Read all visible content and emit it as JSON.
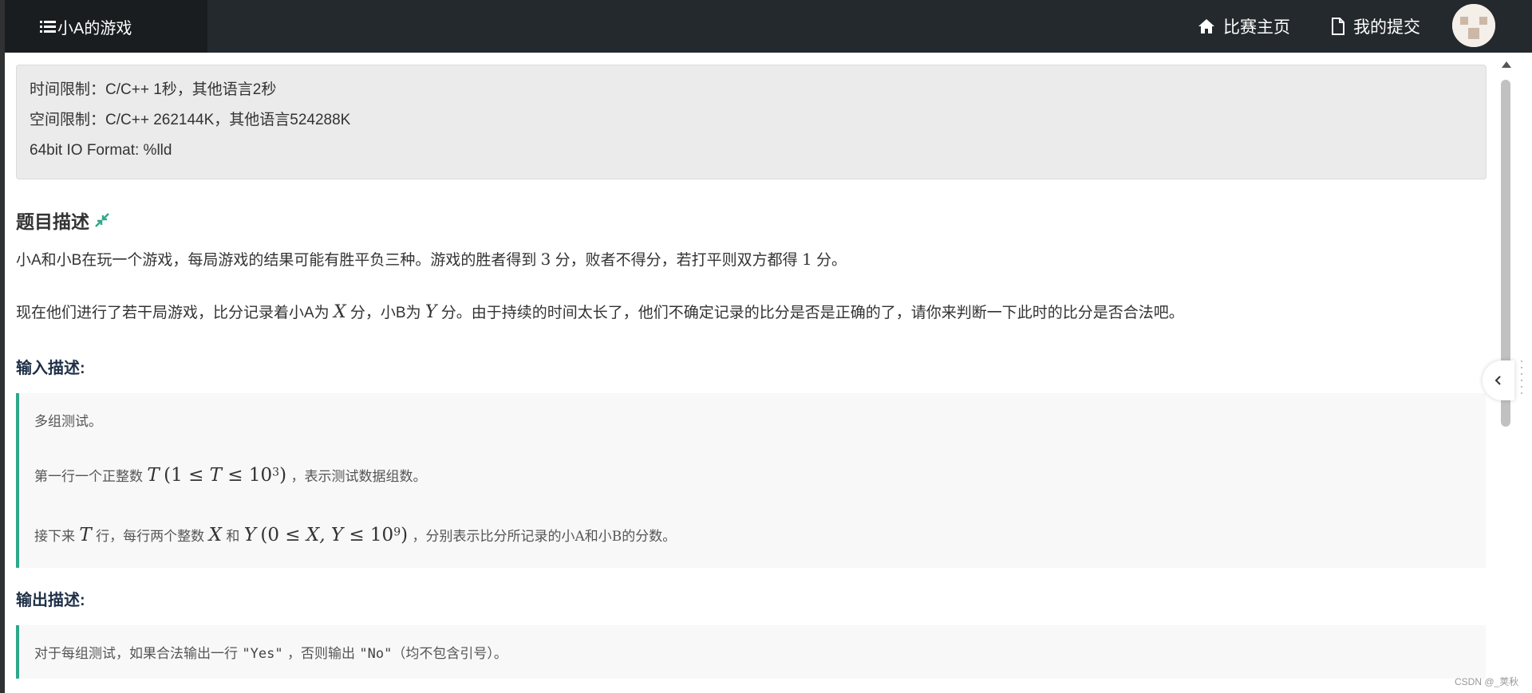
{
  "header": {
    "title": "小A的游戏",
    "nav": [
      {
        "label": "比赛主页",
        "icon": "home-icon"
      },
      {
        "label": "我的提交",
        "icon": "file-icon"
      }
    ]
  },
  "limits": {
    "time": "时间限制：C/C++ 1秒，其他语言2秒",
    "space": "空间限制：C/C++ 262144K，其他语言524288K",
    "format": "64bit IO Format: %lld"
  },
  "description": {
    "heading": "题目描述",
    "p1_before": "小A和小B在玩一个游戏，每局游戏的结果可能有胜平负三种。游戏的胜者得到",
    "p1_n1": "3",
    "p1_mid": "分，败者不得分，若打平则双方都得",
    "p1_n2": "1",
    "p1_after": "分。",
    "p2_a": "现在他们进行了若干局游戏，比分记录着小A为",
    "p2_x": "X",
    "p2_b": "分，小B为",
    "p2_y": "Y",
    "p2_c": "分。由于持续的时间太长了，他们不确定记录的比分是否是正确的了，请你来判断一下此时的比分是否合法吧。"
  },
  "input": {
    "heading": "输入描述:",
    "l1": "多组测试。",
    "l2_a": "第一行一个正整数",
    "l2_T": "T",
    "l2_open": "(1 ≤ ",
    "l2_T2": "T",
    "l2_le": " ≤ 10",
    "l2_exp": "3",
    "l2_close": ")",
    "l2_b": "，表示测试数据组数。",
    "l3_a": "接下来",
    "l3_T": "T",
    "l3_b": "行，每行两个整数",
    "l3_X": "X",
    "l3_and": "和",
    "l3_Y": "Y",
    "l3_open": "(0 ≤ ",
    "l3_XY": "X, Y",
    "l3_le": " ≤ 10",
    "l3_exp": "9",
    "l3_close": ")",
    "l3_c": "，分别表示比分所记录的小A和小B的分数。"
  },
  "output": {
    "heading": "输出描述:",
    "l1_a": "对于每组测试，如果合法输出一行",
    "l1_yes": "\"Yes\"",
    "l1_b": "，否则输出",
    "l1_no": "\"No\"",
    "l1_c": "（均不包含引号）。"
  },
  "watermark": "CSDN @_荚秋",
  "colors": {
    "topbar": "#24292d",
    "accent": "#2ea88a",
    "heading": "#1f3048"
  }
}
